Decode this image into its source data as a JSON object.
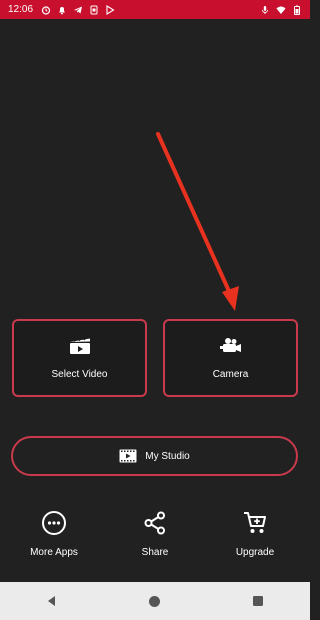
{
  "status_bar": {
    "time": "12:06",
    "left_icons": [
      "alarm-icon",
      "notification-bell-icon",
      "telegram-icon",
      "sim-icon",
      "play-store-icon"
    ],
    "right_icons": [
      "mic-icon",
      "wifi-icon",
      "battery-icon"
    ]
  },
  "cards": [
    {
      "label": "Select Video",
      "icon": "clapperboard-icon"
    },
    {
      "label": "Camera",
      "icon": "video-camera-icon"
    }
  ],
  "studio": {
    "label": "My Studio",
    "icon": "film-strip-icon"
  },
  "actions": [
    {
      "label": "More Apps",
      "icon": "more-dots-icon"
    },
    {
      "label": "Share",
      "icon": "share-icon"
    },
    {
      "label": "Upgrade",
      "icon": "cart-icon"
    }
  ],
  "navbar": {
    "icons": [
      "back-icon",
      "home-icon",
      "recents-icon"
    ]
  },
  "colors": {
    "status_bar": "#c8102e",
    "background": "#212121",
    "accent_border": "#c83a4c",
    "annotation_arrow": "#e8321f",
    "navbar": "#ebebeb"
  }
}
